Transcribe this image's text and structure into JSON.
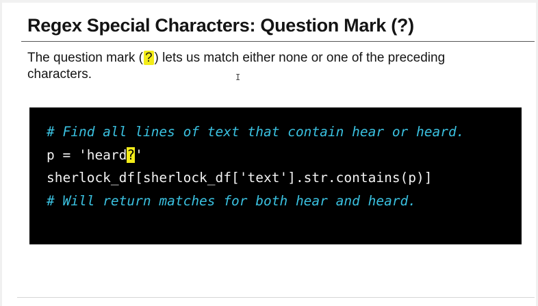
{
  "slide": {
    "title": "Regex Special Characters: Question Mark (?)",
    "paragraph": {
      "before": "The question mark (",
      "highlight": "?",
      "after": ") lets us match either none or one of the preceding characters."
    },
    "cursor_glyph": "I"
  },
  "code": {
    "line1": "# Find all lines of text that contain hear or heard.",
    "line2_before": "p = 'heard",
    "line2_highlight": "?",
    "line2_after": "'",
    "line3": "sherlock_df[sherlock_df['text'].str.contains(p)]",
    "line4": "# Will return matches for both hear and heard."
  },
  "colors": {
    "background": "#ffffff",
    "code_background": "#000000",
    "code_text": "#f2f2f2",
    "comment": "#3ac0df",
    "highlight": "#f3ec19"
  }
}
